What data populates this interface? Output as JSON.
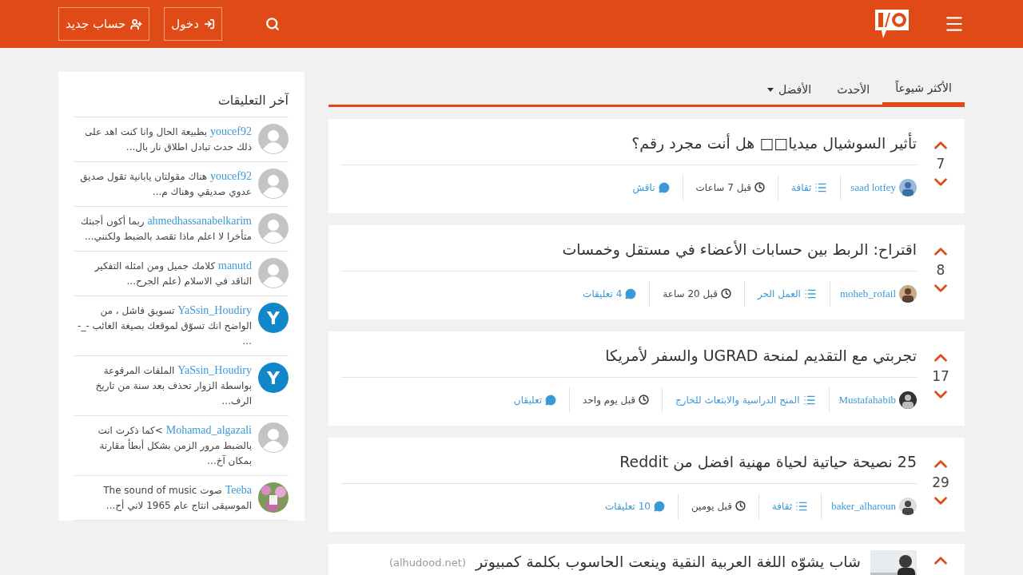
{
  "header": {
    "buttons": [
      {
        "kind": "login",
        "label": "دخول"
      },
      {
        "kind": "register",
        "label": "حساب جديد"
      }
    ]
  },
  "tabs": [
    {
      "label": "الأكثر شيوعاً",
      "selected": true,
      "dropdown": false
    },
    {
      "label": "الأحدث",
      "selected": false,
      "dropdown": false
    },
    {
      "label": "الأفضل",
      "selected": false,
      "dropdown": true
    }
  ],
  "posts": [
    {
      "kind": "text",
      "votes": "7",
      "title": "تأثير السوشيال ميديا□□ هل أنت مجرد رقم؟",
      "author": "saad lotfey",
      "category": "ثقافة",
      "time": "قبل 7 ساعات",
      "comments": "ناقش"
    },
    {
      "kind": "text",
      "votes": "8",
      "title": "اقتراح: الربط بين حسابات الأعضاء في مستقل وخمسات",
      "author": "moheb_rofail",
      "category": "العمل الحر",
      "time": "قبل 20 ساعة",
      "comments": "4 تعليقات"
    },
    {
      "kind": "text",
      "votes": "17",
      "title": "تجربتي مع التقديم لمنحة UGRAD والسفر لأمريكا",
      "author": "Mustafahabib",
      "category": "المنح الدراسية والابتعاث للخارج",
      "time": "قبل يوم واحد",
      "comments": "تعليقان"
    },
    {
      "kind": "text",
      "votes": "29",
      "title": "25 نصيحة حياتية لحياة مهنية افضل من Reddit",
      "author": "baker_alharoun",
      "category": "ثقافة",
      "time": "قبل يومين",
      "comments": "10 تعليقات"
    },
    {
      "kind": "link",
      "title": "شاب يشوّه اللغة العربية النقية وينعت الحاسوب بكلمة كمبيوتر",
      "domain": "(alhudood.net)"
    }
  ],
  "sidebar": {
    "title": "آخر التعليقات",
    "comments": [
      {
        "kind": "default",
        "user": "youcef92",
        "text": "بطبيعة الحال وانا كنت اهد على ذلك حدث تبادل اطلاق نار بال..."
      },
      {
        "kind": "default",
        "user": "youcef92",
        "text": "هناك مقولتان يابانية تقول صديق عدوي صديقي وهناك م..."
      },
      {
        "kind": "default",
        "user": "ahmedhassanabelkarim",
        "text": "ربما أكون أجبتك متأخرا لا اعلم ماذا تقصد بالضبط ولكنني..."
      },
      {
        "kind": "default",
        "user": "manutd",
        "text": "كلامك جميل ومن امثله التفكير الناقد في الاسلام (علم الجرح..."
      },
      {
        "kind": "letter",
        "letter": "Y",
        "user": "YaSsin_Houdiry",
        "text": "تسويق فاشل ، من الواضح انك تسوّق لموقعك بصيغة الغائب -_- ..."
      },
      {
        "kind": "letter",
        "letter": "Y",
        "user": "YaSsin_Houdiry",
        "text": "الملفات المرفوعة بواسطة الزوار تحذف بعد سنة من تاريخ الرف..."
      },
      {
        "kind": "default",
        "user": "Mohamad_algazali",
        "text": ">كما ذكرت انت بالضبط مرور الزمن بشكل أبطأ مقارنة بمكان آخ..."
      },
      {
        "kind": "picture",
        "user": "Teeba",
        "text": "صوت The sound of music الموسيقى انتاج عام 1965 لاني أح..."
      }
    ]
  }
}
